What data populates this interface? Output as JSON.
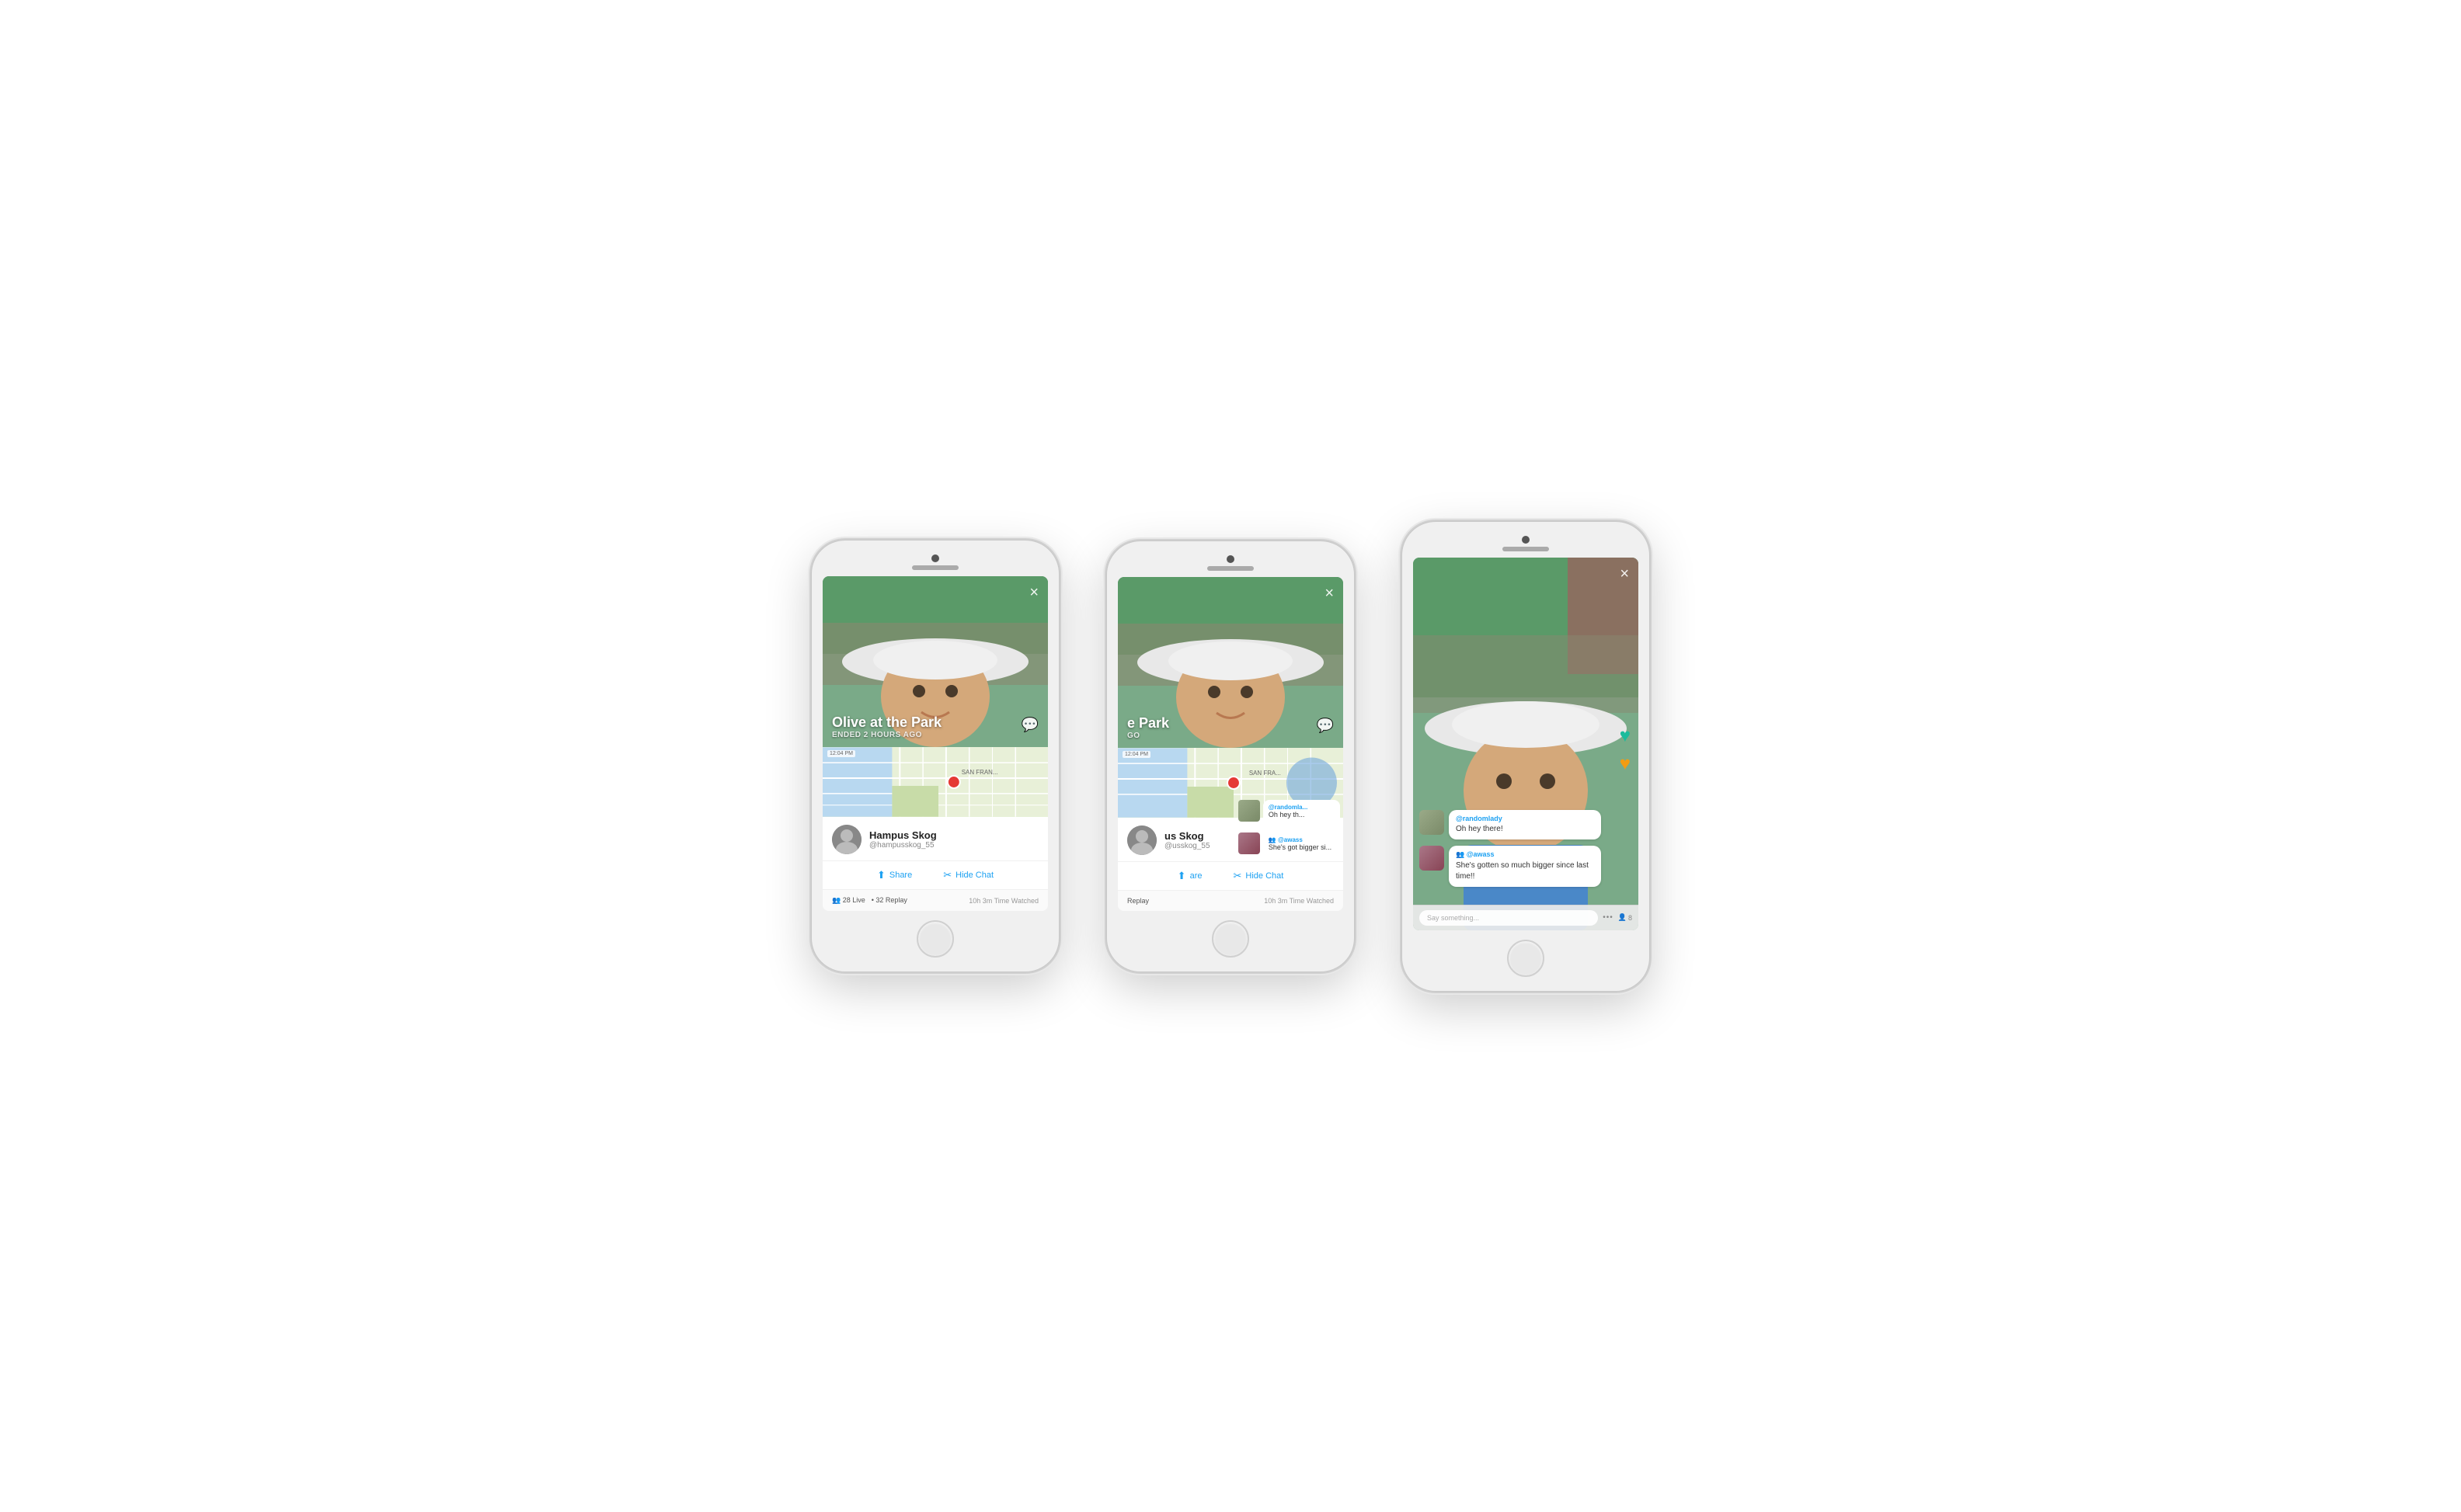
{
  "phones": [
    {
      "id": "phone1",
      "screen": "map-view",
      "video": {
        "title": "Olive at the Park",
        "ended": "ENDED 2 hours ago",
        "close": "×",
        "chat_icon": "💬"
      },
      "map": {
        "time": "12:04 PM",
        "label": "SAN FRAN..."
      },
      "profile": {
        "name": "Hampus Skog",
        "handle": "@hampusskog_55"
      },
      "actions": [
        {
          "label": "Share",
          "icon": "share"
        },
        {
          "label": "Hide Chat",
          "icon": "hide"
        }
      ],
      "stats": {
        "live": "28 Live",
        "replay": "32 Replay",
        "time_watched": "10h 3m Time Watched"
      }
    },
    {
      "id": "phone2",
      "screen": "transition",
      "video": {
        "title": "e Park",
        "ended": "go",
        "close": "×",
        "chat_icon": "💬"
      },
      "map": {
        "time": "12:04 PM",
        "label": "SAN FRA..."
      },
      "profile": {
        "name": "us Skog",
        "handle": "@usskog_55"
      },
      "actions": [
        {
          "label": "are",
          "icon": "share"
        },
        {
          "label": "Hide Chat",
          "icon": "hide"
        }
      ],
      "stats": {
        "replay": "Replay",
        "time_watched": "10h 3m Time Watched"
      },
      "chat_preview": [
        {
          "username": "@randomla...",
          "text": "Oh hey th..."
        },
        {
          "username": "@awass",
          "text": "She's got bigger si..."
        }
      ]
    },
    {
      "id": "phone3",
      "screen": "chat-view",
      "video": {
        "close": "×"
      },
      "chat_messages": [
        {
          "username": "@randomlady",
          "text": "Oh hey there!",
          "avatar_color": "#9aaa88"
        },
        {
          "username": "@awass",
          "text": "She's gotten so much bigger since last time!!",
          "avatar_color": "#aa7788",
          "has_group_icon": true
        }
      ],
      "input": {
        "placeholder": "Say something...",
        "dots": "•••",
        "viewers": "8"
      },
      "hearts": [
        {
          "color": "teal",
          "symbol": "♥"
        },
        {
          "color": "yellow",
          "symbol": "♥"
        }
      ]
    }
  ]
}
